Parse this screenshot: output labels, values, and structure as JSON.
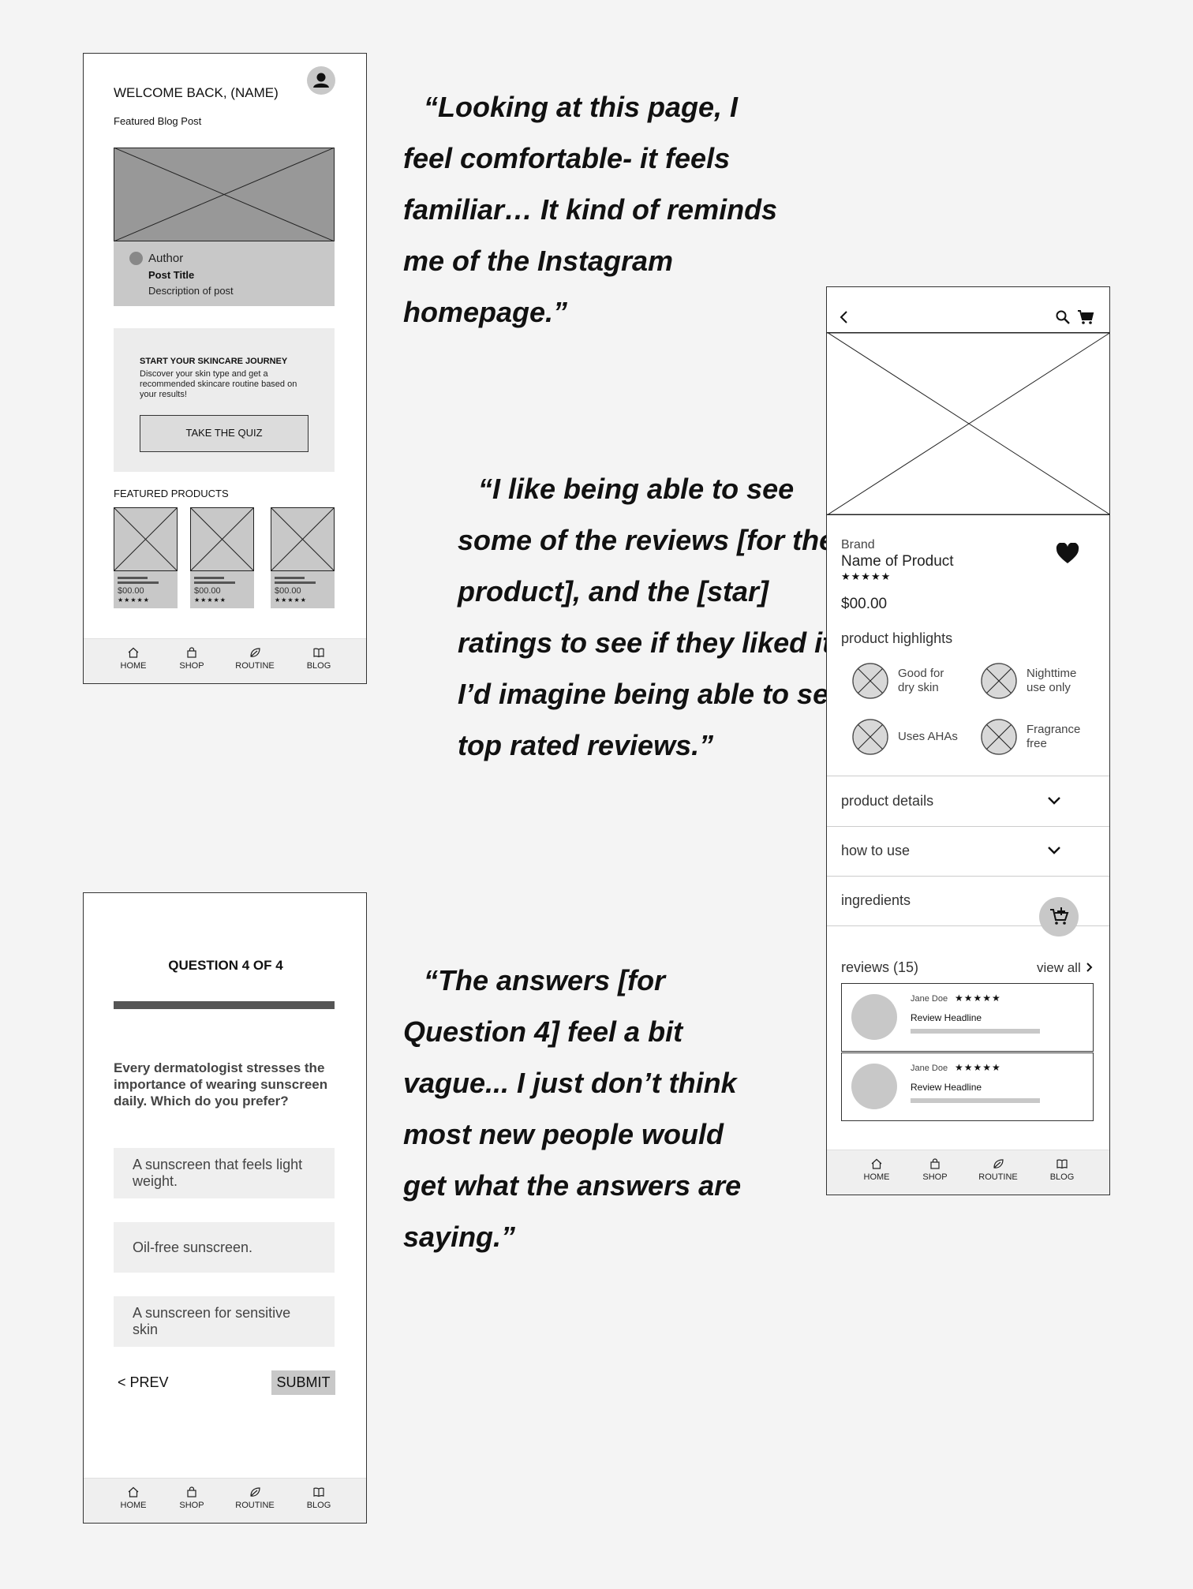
{
  "home_screen": {
    "welcome": "WELCOME BACK, (NAME)",
    "featured_blog_label": "Featured Blog Post",
    "author": "Author",
    "post_title": "Post Title",
    "post_desc": "Description of post",
    "journey_title": "START YOUR SKINCARE JOURNEY",
    "journey_body": "Discover your skin type and get a recommended skincare routine based on your results!",
    "quiz_button": "TAKE THE QUIZ",
    "featured_products_label": "FEATURED PRODUCTS",
    "products": [
      {
        "price": "$00.00",
        "stars": "★★★★★"
      },
      {
        "price": "$00.00",
        "stars": "★★★★★"
      },
      {
        "price": "$00.00",
        "stars": "★★★★★"
      }
    ]
  },
  "nav": [
    "HOME",
    "SHOP",
    "ROUTINE",
    "BLOG"
  ],
  "quotes": {
    "q1": [
      "“Looking at this page, I",
      "feel comfortable- it feels",
      "familiar… It kind of reminds",
      "me of the Instagram",
      "homepage.”"
    ],
    "q2": [
      "“I like being able to see",
      "some of the reviews [for the",
      "product], and the [star]",
      "ratings to see if they liked it.",
      "I’d imagine being able to see",
      "top rated reviews.”"
    ],
    "q3": [
      "“The answers [for",
      "Question 4] feel a bit",
      "vague... I just don’t think",
      "most new people would",
      "get what the answers are",
      "saying.”"
    ]
  },
  "quiz_screen": {
    "question_header": "QUESTION 4 OF 4",
    "progress": 1.0,
    "question": "Every dermatologist stresses the importance of wearing sunscreen daily. Which do you prefer?",
    "answers": [
      "A sunscreen that feels light weight.",
      "Oil-free sunscreen.",
      "A sunscreen for sensitive skin"
    ],
    "prev": "< PREV",
    "submit": "SUBMIT"
  },
  "product_screen": {
    "brand": "Brand",
    "name": "Name of Product",
    "stars": "★★★★★",
    "price": "$00.00",
    "highlights_label": "product highlights",
    "highlights": [
      "Good for\ndry skin",
      "Nighttime\nuse only",
      "Uses AHAs",
      "Fragrance\nfree"
    ],
    "accordion": [
      "product details",
      "how to use",
      "ingredients"
    ],
    "reviews_label": "reviews (15)",
    "view_all": "view all",
    "reviews": [
      {
        "name": "Jane Doe",
        "stars": "★★★★★",
        "headline": "Review Headline"
      },
      {
        "name": "Jane Doe",
        "stars": "★★★★★",
        "headline": "Review Headline"
      }
    ]
  },
  "icons": [
    "user-icon",
    "back-arrow-icon",
    "search-icon",
    "cart-icon",
    "heart-icon",
    "chevron-down-icon",
    "add-to-cart-icon",
    "chevron-right-icon",
    "home-icon",
    "shop-bag-icon",
    "routine-leaf-icon",
    "blog-book-icon"
  ]
}
